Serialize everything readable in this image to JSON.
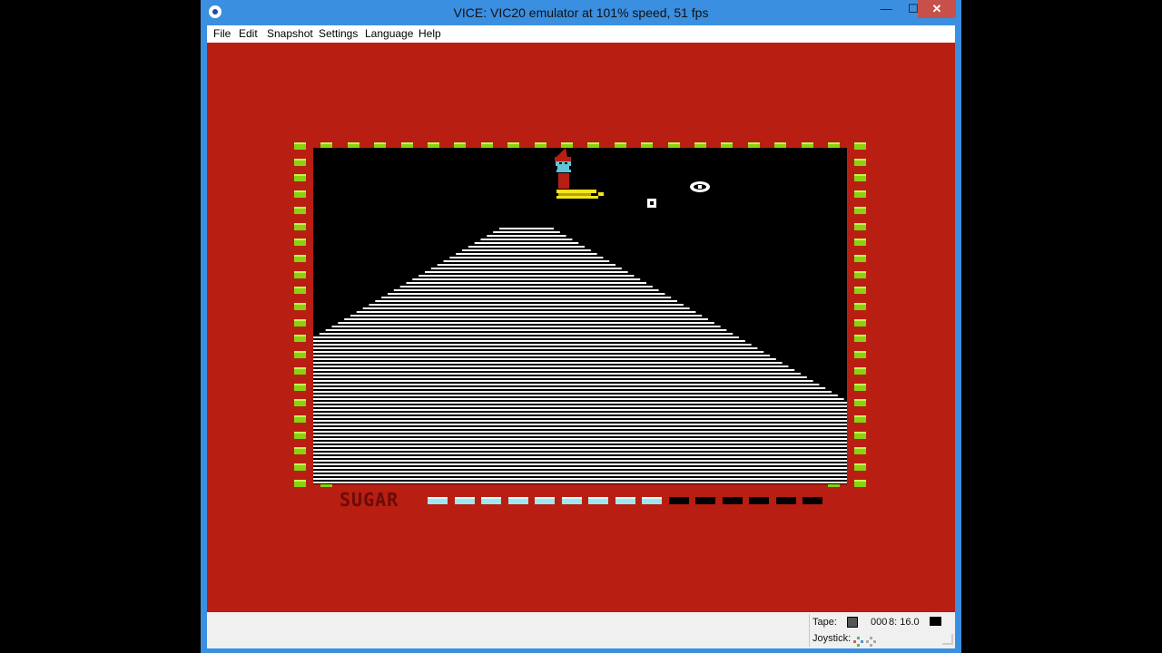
{
  "window": {
    "title": "VICE: VIC20 emulator at 101% speed, 51 fps",
    "controls": {
      "minimize": "—",
      "maximize": "☐",
      "close": "✕"
    }
  },
  "menu": {
    "items": [
      {
        "id": "file",
        "label": "File"
      },
      {
        "id": "edit",
        "label": "Edit"
      },
      {
        "id": "snapshot",
        "label": "Snapshot"
      },
      {
        "id": "settings",
        "label": "Settings"
      },
      {
        "id": "language",
        "label": "Language"
      },
      {
        "id": "help",
        "label": "Help"
      }
    ]
  },
  "game": {
    "sugar_label": "SUGAR",
    "sugar_meter": {
      "filled": 9,
      "total": 15
    },
    "colors": {
      "border": "#b81e12",
      "playfield": "#000000",
      "brick": "#8ad20e",
      "sugar_full": "#9fe6f0",
      "hill": "#ffffff",
      "sled": "#f2e61c",
      "hat": "#b81e12",
      "face": "#62c3d8"
    }
  },
  "status": {
    "tape_label": "Tape:",
    "tape_counter": "000",
    "drive": "8: 16.0",
    "joystick_label": "Joystick:"
  },
  "icons": {
    "app": "vice-logo-icon",
    "tape": "tape-icon",
    "drive_led": "drive-led-icon",
    "joystick": "joystick-indicator-icon"
  }
}
